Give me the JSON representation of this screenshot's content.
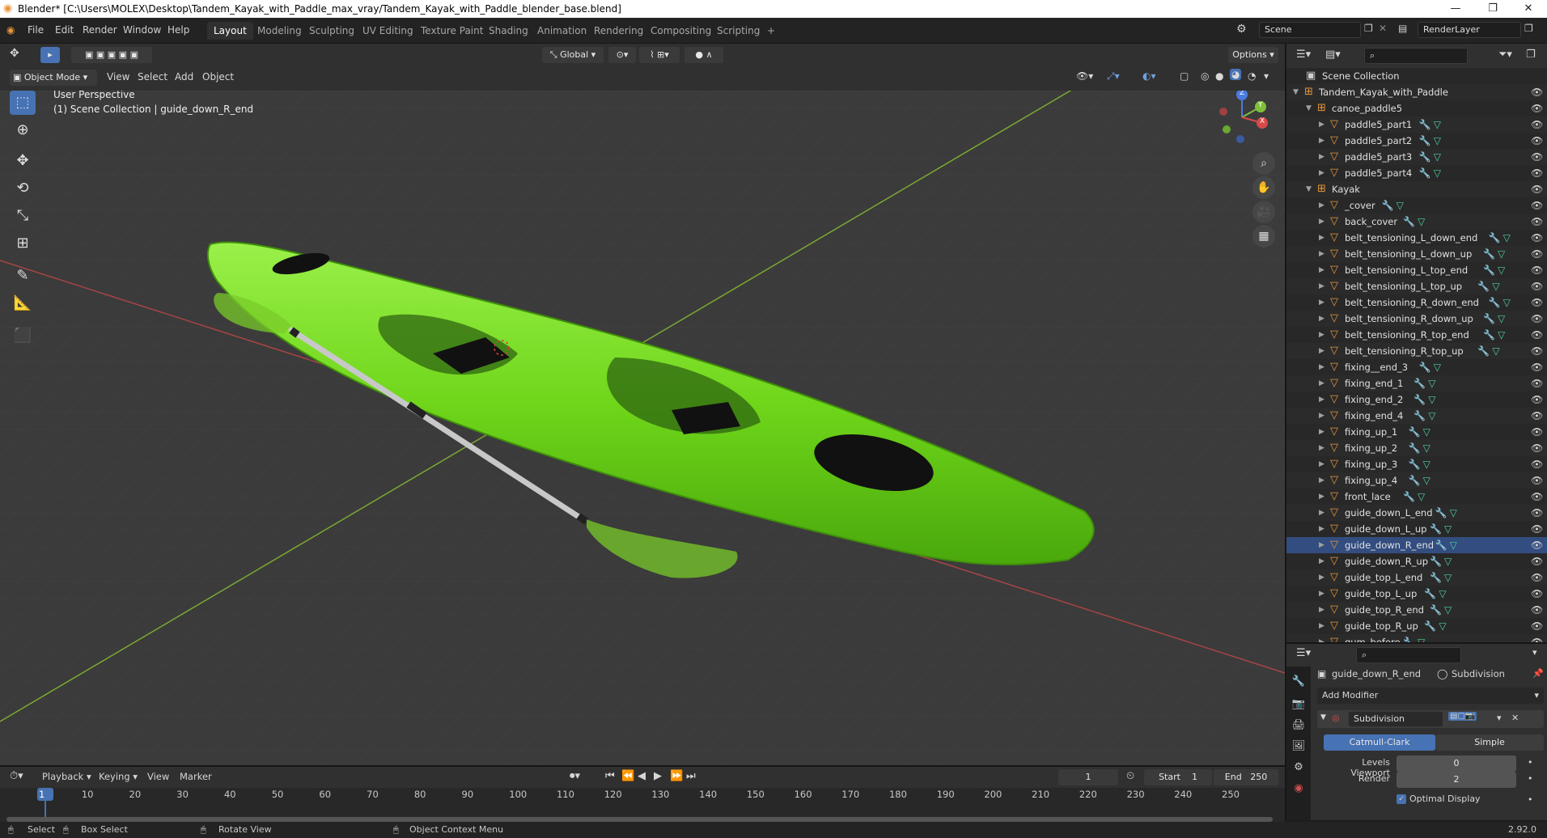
{
  "window": {
    "title": "Blender* [C:\\Users\\MOLEX\\Desktop\\Tandem_Kayak_with_Paddle_max_vray/Tandem_Kayak_with_Paddle_blender_base.blend]",
    "min": "—",
    "max": "❐",
    "close": "✕"
  },
  "menu": [
    "File",
    "Edit",
    "Render",
    "Window",
    "Help"
  ],
  "workspaces": [
    "Layout",
    "Modeling",
    "Sculpting",
    "UV Editing",
    "Texture Paint",
    "Shading",
    "Animation",
    "Rendering",
    "Compositing",
    "Scripting",
    "+"
  ],
  "scene": {
    "name": "Scene",
    "render_layer": "RenderLayer"
  },
  "header3d": {
    "mode": "Object Mode",
    "menus": [
      "View",
      "Select",
      "Add",
      "Object"
    ],
    "transform": "Global",
    "options": "Options"
  },
  "viewport": {
    "perspective": "User Perspective",
    "collection_info": "(1) Scene Collection | guide_down_R_end",
    "axis_labels": {
      "z": "Z",
      "y": "Y",
      "x": "X"
    },
    "kayak_color": "#6fd61a",
    "grid_x_color": "#b04040",
    "grid_y_color": "#7ca832"
  },
  "outliner": {
    "root": "Scene Collection",
    "items": [
      {
        "label": "Tandem_Kayak_with_Paddle",
        "level": 0,
        "type": "collection",
        "open": true
      },
      {
        "label": "canoe_paddle5",
        "level": 1,
        "type": "collection",
        "open": true
      },
      {
        "label": "paddle5_part1",
        "level": 2,
        "type": "mesh"
      },
      {
        "label": "paddle5_part2",
        "level": 2,
        "type": "mesh"
      },
      {
        "label": "paddle5_part3",
        "level": 2,
        "type": "mesh"
      },
      {
        "label": "paddle5_part4",
        "level": 2,
        "type": "mesh"
      },
      {
        "label": "Kayak",
        "level": 1,
        "type": "collection",
        "open": true
      },
      {
        "label": "_cover",
        "level": 2,
        "type": "mesh"
      },
      {
        "label": "back_cover",
        "level": 2,
        "type": "mesh"
      },
      {
        "label": "belt_tensioning_L_down_end",
        "level": 2,
        "type": "mesh"
      },
      {
        "label": "belt_tensioning_L_down_up",
        "level": 2,
        "type": "mesh"
      },
      {
        "label": "belt_tensioning_L_top_end",
        "level": 2,
        "type": "mesh"
      },
      {
        "label": "belt_tensioning_L_top_up",
        "level": 2,
        "type": "mesh"
      },
      {
        "label": "belt_tensioning_R_down_end",
        "level": 2,
        "type": "mesh"
      },
      {
        "label": "belt_tensioning_R_down_up",
        "level": 2,
        "type": "mesh"
      },
      {
        "label": "belt_tensioning_R_top_end",
        "level": 2,
        "type": "mesh"
      },
      {
        "label": "belt_tensioning_R_top_up",
        "level": 2,
        "type": "mesh"
      },
      {
        "label": "fixing__end_3",
        "level": 2,
        "type": "mesh"
      },
      {
        "label": "fixing_end_1",
        "level": 2,
        "type": "mesh"
      },
      {
        "label": "fixing_end_2",
        "level": 2,
        "type": "mesh"
      },
      {
        "label": "fixing_end_4",
        "level": 2,
        "type": "mesh"
      },
      {
        "label": "fixing_up_1",
        "level": 2,
        "type": "mesh"
      },
      {
        "label": "fixing_up_2",
        "level": 2,
        "type": "mesh"
      },
      {
        "label": "fixing_up_3",
        "level": 2,
        "type": "mesh"
      },
      {
        "label": "fixing_up_4",
        "level": 2,
        "type": "mesh"
      },
      {
        "label": "front_lace",
        "level": 2,
        "type": "mesh"
      },
      {
        "label": "guide_down_L_end",
        "level": 2,
        "type": "mesh"
      },
      {
        "label": "guide_down_L_up",
        "level": 2,
        "type": "mesh"
      },
      {
        "label": "guide_down_R_end",
        "level": 2,
        "type": "mesh",
        "selected": true
      },
      {
        "label": "guide_down_R_up",
        "level": 2,
        "type": "mesh"
      },
      {
        "label": "guide_top_L_end",
        "level": 2,
        "type": "mesh"
      },
      {
        "label": "guide_top_L_up",
        "level": 2,
        "type": "mesh"
      },
      {
        "label": "guide_top_R_end",
        "level": 2,
        "type": "mesh"
      },
      {
        "label": "guide_top_R_up",
        "level": 2,
        "type": "mesh"
      },
      {
        "label": "gum_before",
        "level": 2,
        "type": "mesh"
      }
    ]
  },
  "properties": {
    "object": "guide_down_R_end",
    "modifier_context": "Subdivision",
    "add_modifier": "Add Modifier",
    "modifier_name": "Subdivision",
    "method_a": "Catmull-Clark",
    "method_b": "Simple",
    "levels_viewport_label": "Levels Viewport",
    "levels_viewport": "0",
    "render_label": "Render",
    "render_value": "2",
    "optimal_label": "Optimal Display"
  },
  "timeline": {
    "menus": [
      "Playback",
      "Keying",
      "View",
      "Marker"
    ],
    "current_frame": "1",
    "start_label": "Start",
    "start": "1",
    "end_label": "End",
    "end": "250",
    "ticks": [
      "1",
      "10",
      "20",
      "30",
      "40",
      "50",
      "60",
      "70",
      "80",
      "90",
      "100",
      "110",
      "120",
      "130",
      "140",
      "150",
      "160",
      "170",
      "180",
      "190",
      "200",
      "210",
      "220",
      "230",
      "240",
      "250"
    ]
  },
  "status": {
    "select": "Select",
    "box_select": "Box Select",
    "rotate": "Rotate View",
    "context_menu": "Object Context Menu",
    "version": "2.92.0"
  }
}
